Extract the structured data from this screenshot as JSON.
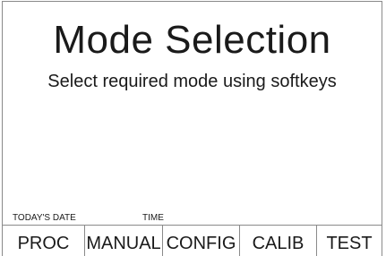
{
  "screen": {
    "title": "Mode Selection",
    "instruction": "Select required mode using softkeys"
  },
  "status": {
    "date_label": "TODAY'S DATE",
    "time_label": "TIME"
  },
  "softkeys": [
    {
      "label": "PROC"
    },
    {
      "label": "MANUAL"
    },
    {
      "label": "CONFIG"
    },
    {
      "label": "CALIB"
    },
    {
      "label": "TEST"
    }
  ]
}
